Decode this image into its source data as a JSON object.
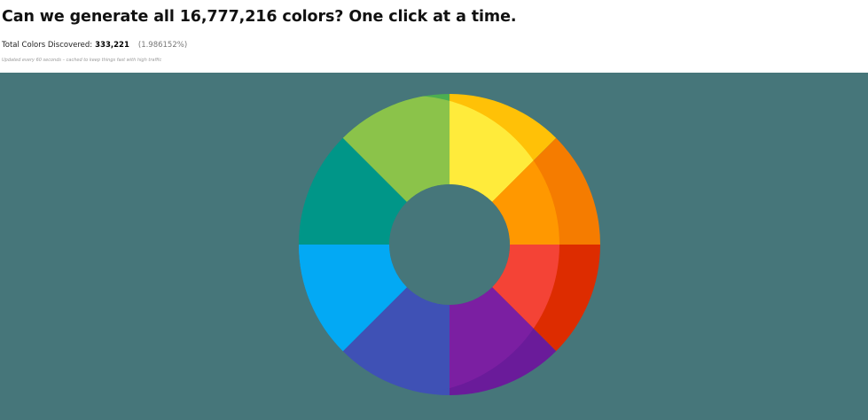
{
  "header": {
    "title": "Can we generate all 16,777,216 colors? One click at a time.",
    "stats_label": "Total Colors Discovered:",
    "stats_count": "333,221",
    "stats_percent": "(1.986152%)",
    "update_note": "Updated every 60 seconds – cached to keep things fast with high traffic"
  },
  "canvas": {
    "background": "#46767a"
  },
  "wheel": {
    "segments": [
      {
        "name": "yellow",
        "color": "#ffeb3b",
        "rim": "#ffc107"
      },
      {
        "name": "orange",
        "color": "#ff9800",
        "rim": "#f57c00"
      },
      {
        "name": "red",
        "color": "#f44336",
        "rim": "#dd2c00"
      },
      {
        "name": "purple",
        "color": "#7b1fa2",
        "rim": "#6a1b9a"
      },
      {
        "name": "indigo",
        "color": "#3f51b5",
        "rim": "#3f51b5"
      },
      {
        "name": "light-blue",
        "color": "#03a9f4",
        "rim": "#03a9f4"
      },
      {
        "name": "teal",
        "color": "#009688",
        "rim": "#009688"
      },
      {
        "name": "light-green",
        "color": "#8bc34a",
        "rim": "#4caf50"
      }
    ]
  }
}
